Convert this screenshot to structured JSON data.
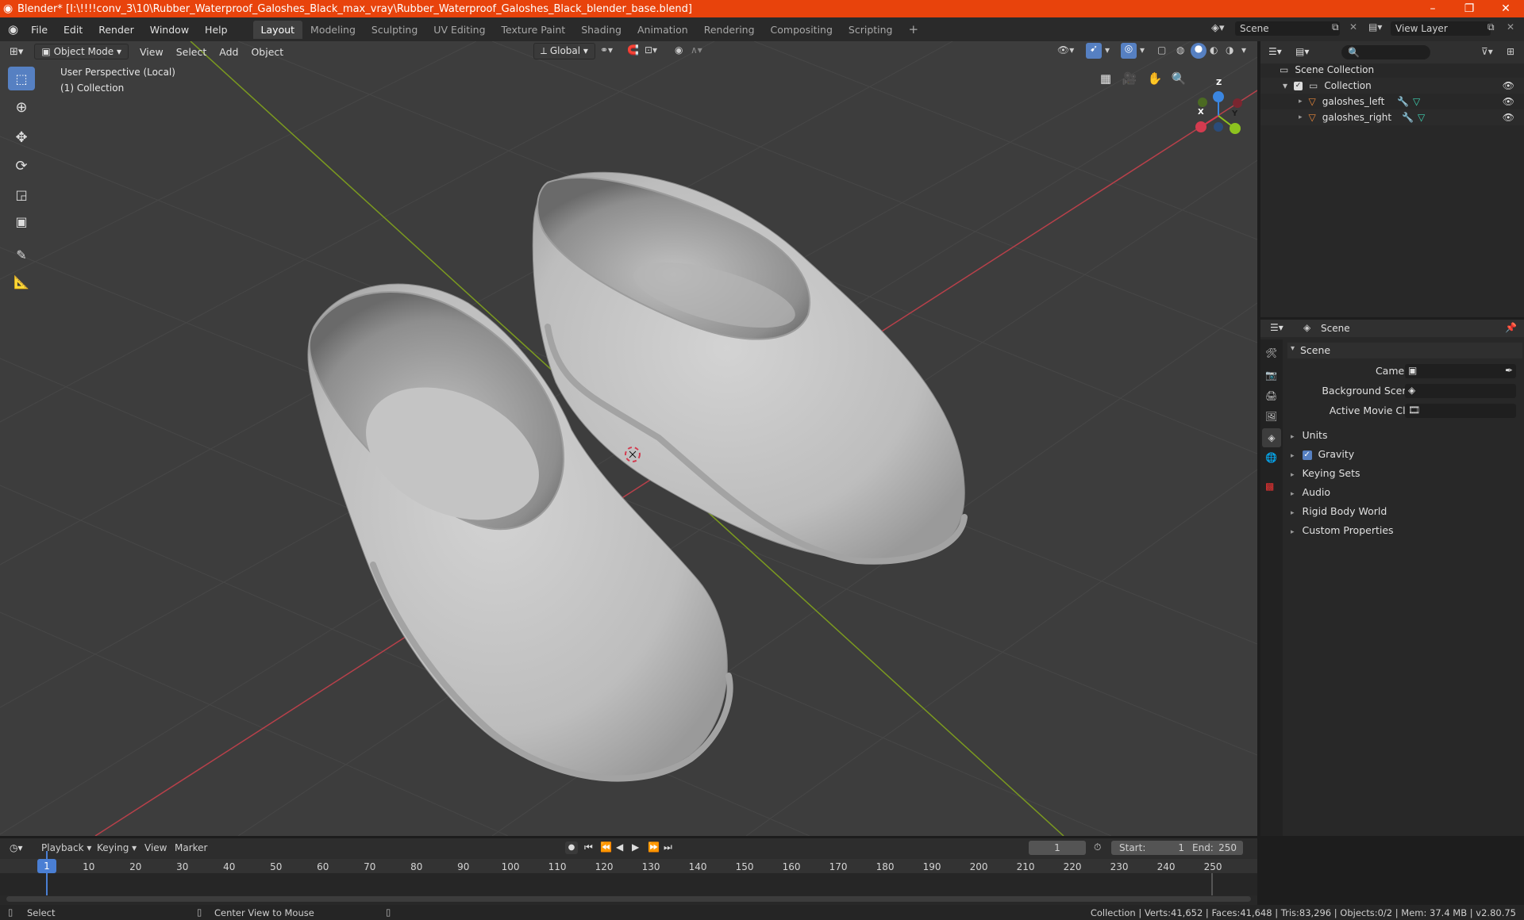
{
  "window": {
    "title": "Blender* [I:\\!!!!conv_3\\10\\Rubber_Waterproof_Galoshes_Black_max_vray\\Rubber_Waterproof_Galoshes_Black_blender_base.blend]",
    "minimize": "–",
    "restore": "❐",
    "close": "✕"
  },
  "menubar": {
    "menus": [
      "File",
      "Edit",
      "Render",
      "Window",
      "Help"
    ],
    "workspaces": [
      "Layout",
      "Modeling",
      "Sculpting",
      "UV Editing",
      "Texture Paint",
      "Shading",
      "Animation",
      "Rendering",
      "Compositing",
      "Scripting"
    ],
    "active_workspace": "Layout",
    "add_tab": "+",
    "scene_name": "Scene",
    "view_layer": "View Layer"
  },
  "viewport": {
    "mode": "Object Mode",
    "menus": [
      "View",
      "Select",
      "Add",
      "Object"
    ],
    "orientation": "Global",
    "overlay_text_line1": "User Perspective (Local)",
    "overlay_text_line2": "(1) Collection",
    "gizmo_axes": {
      "x": "X",
      "y": "Y",
      "z": "Z"
    },
    "background_color": "#3d3d3d",
    "mesh_color": "#c6c6c6"
  },
  "outliner": {
    "root": "Scene Collection",
    "collection": "Collection",
    "objects": [
      "galoshes_left",
      "galoshes_right"
    ]
  },
  "properties": {
    "breadcrumb": "Scene",
    "panel_title": "Scene",
    "fields": [
      {
        "label": "Camera",
        "value": ""
      },
      {
        "label": "Background Scene",
        "value": ""
      },
      {
        "label": "Active Movie Clip",
        "value": ""
      }
    ],
    "sections": [
      "Units",
      "Gravity",
      "Keying Sets",
      "Audio",
      "Rigid Body World",
      "Custom Properties"
    ],
    "gravity_checked": true
  },
  "timeline": {
    "menus": [
      "Playback",
      "Keying",
      "View",
      "Marker"
    ],
    "current_frame": "1",
    "start_label": "Start:",
    "start": "1",
    "end_label": "End:",
    "end": "250",
    "ruler": [
      "1",
      "10",
      "20",
      "30",
      "40",
      "50",
      "60",
      "70",
      "80",
      "90",
      "100",
      "110",
      "120",
      "130",
      "140",
      "150",
      "160",
      "170",
      "180",
      "190",
      "200",
      "210",
      "220",
      "230",
      "240",
      "250"
    ]
  },
  "statusbar": {
    "left_action": "Select",
    "middle_action": "Center View to Mouse",
    "stats": "Collection | Verts:41,652 | Faces:41,648 | Tris:83,296 | Objects:0/2 | Mem: 37.4 MB | v2.80.75"
  },
  "colors": {
    "title_bar": "#e8430c",
    "active_tool": "#5680c2",
    "x_axis": "#d33b4f",
    "y_axis": "#8dc21f",
    "z_axis": "#3b86e0",
    "frame_marker": "#4a7fd4"
  }
}
